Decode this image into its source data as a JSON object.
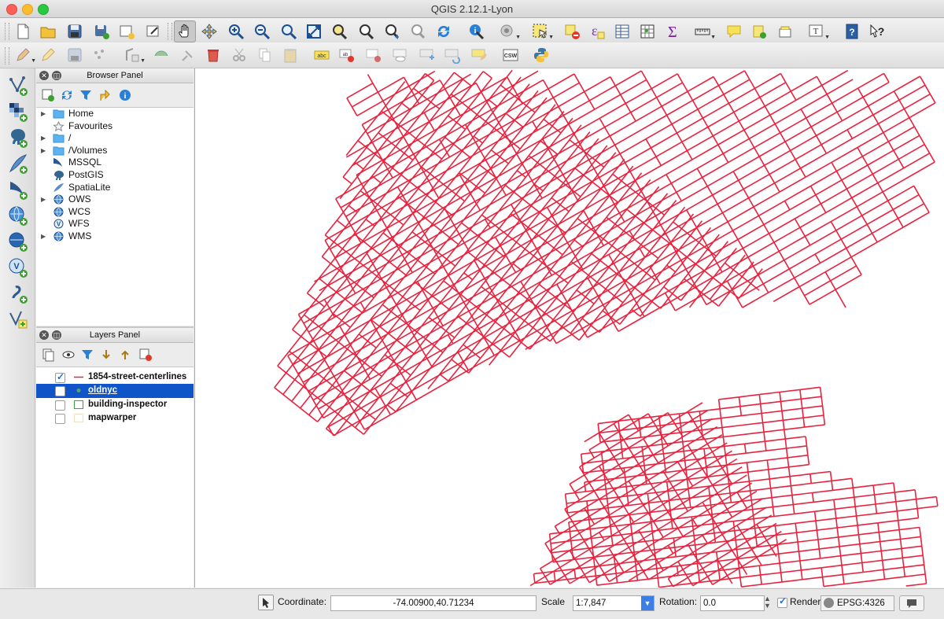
{
  "window": {
    "title": "QGIS 2.12.1-Lyon"
  },
  "browser_panel": {
    "title": "Browser Panel",
    "items": [
      {
        "label": "Home",
        "icon": "folder-icon",
        "expandable": true
      },
      {
        "label": "Favourites",
        "icon": "star-icon",
        "expandable": false
      },
      {
        "label": "/",
        "icon": "folder-icon",
        "expandable": true
      },
      {
        "label": "/Volumes",
        "icon": "folder-icon",
        "expandable": true
      },
      {
        "label": "MSSQL",
        "icon": "mssql-icon",
        "expandable": false
      },
      {
        "label": "PostGIS",
        "icon": "postgis-elephant-icon",
        "expandable": false
      },
      {
        "label": "SpatiaLite",
        "icon": "spatialite-feather-icon",
        "expandable": false
      },
      {
        "label": "OWS",
        "icon": "globe-icon",
        "expandable": true
      },
      {
        "label": "WCS",
        "icon": "globe-icon",
        "expandable": false
      },
      {
        "label": "WFS",
        "icon": "wfs-icon",
        "expandable": false
      },
      {
        "label": "WMS",
        "icon": "globe-icon",
        "expandable": true
      }
    ]
  },
  "layers_panel": {
    "title": "Layers Panel",
    "layers": [
      {
        "name": "1854-street-centerlines",
        "visible": true,
        "selected": false,
        "symbol": "line"
      },
      {
        "name": "oldnyc",
        "visible": false,
        "selected": true,
        "symbol": "point"
      },
      {
        "name": "building-inspector",
        "visible": false,
        "selected": false,
        "symbol": "polygon"
      },
      {
        "name": "mapwarper",
        "visible": false,
        "selected": false,
        "symbol": "raster"
      }
    ]
  },
  "status_bar": {
    "coordinate_label": "Coordinate:",
    "coordinate_value": "-74.00900,40.71234",
    "scale_label": "Scale",
    "scale_value": "1:7,847",
    "rotation_label": "Rotation:",
    "rotation_value": "0.0",
    "render_label": "Render",
    "render_checked": true,
    "crs_label": "EPSG:4326"
  },
  "map": {
    "line_color": "#e8233f",
    "background": "#ffffff"
  }
}
